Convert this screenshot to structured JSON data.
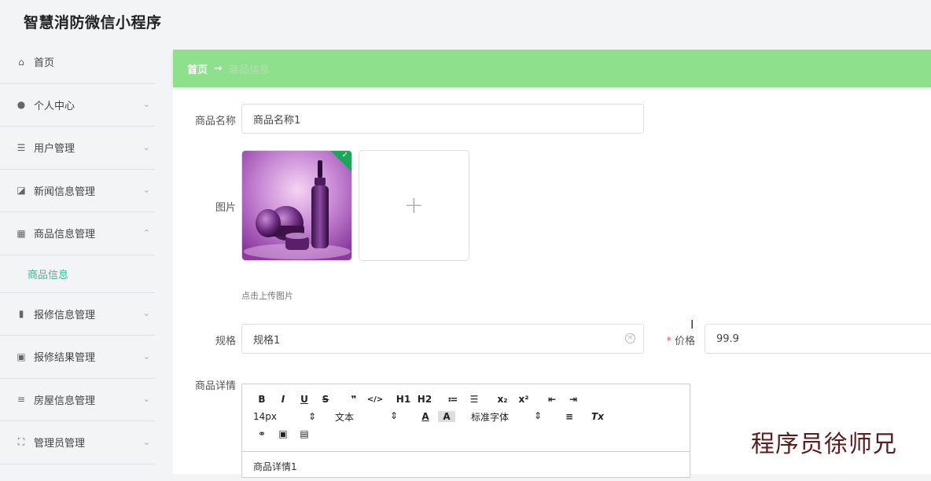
{
  "app": {
    "title": "智慧消防微信小程序"
  },
  "sidebar": {
    "items": [
      {
        "label": "首页",
        "icon": "home-icon",
        "glyph": "⌂",
        "chev": ""
      },
      {
        "label": "个人中心",
        "icon": "user-icon",
        "glyph": "●",
        "chev": "⌄"
      },
      {
        "label": "用户管理",
        "icon": "list-icon",
        "glyph": "☰",
        "chev": "⌄"
      },
      {
        "label": "新闻信息管理",
        "icon": "trend-chart-icon",
        "glyph": "◪",
        "chev": "⌄"
      },
      {
        "label": "商品信息管理",
        "icon": "grid-icon",
        "glyph": "▦",
        "chev": "⌃"
      },
      {
        "label": "报修信息管理",
        "icon": "bar-chart-icon",
        "glyph": "▮",
        "chev": "⌄"
      },
      {
        "label": "报修结果管理",
        "icon": "clipboard-icon",
        "glyph": "▣",
        "chev": "⌄"
      },
      {
        "label": "房屋信息管理",
        "icon": "menu-lines-icon",
        "glyph": "≡",
        "chev": "⌄"
      },
      {
        "label": "管理员管理",
        "icon": "frame-icon",
        "glyph": "⛶",
        "chev": "⌄"
      }
    ],
    "subitem": {
      "label": "商品信息"
    }
  },
  "breadcrumb": {
    "home": "首页",
    "arrow": "→",
    "current": "商品信息"
  },
  "form": {
    "name_label": "商品名称",
    "name_value": "商品名称1",
    "image_label": "图片",
    "upload_tip": "点击上传图片",
    "spec_label": "规格",
    "spec_value": "规格1",
    "price_required": "*",
    "price_label": "价格",
    "price_value": "99.9",
    "detail_label": "商品详情"
  },
  "editor": {
    "row1": [
      "B",
      "I",
      "U",
      "S",
      "❞",
      "</>",
      "H1",
      "H2",
      "≔",
      "☰",
      "x₂",
      "x²",
      "⇤",
      "⇥"
    ],
    "font_size": "14px",
    "header_select": "文本",
    "font_family": "标准字体",
    "content": "商品详情1"
  },
  "watermark": "程序员徐师兄",
  "colors": {
    "breadcrumb_bg": "#8ee08c",
    "active_sub": "#2fbf9c",
    "check_badge": "#18a858"
  }
}
